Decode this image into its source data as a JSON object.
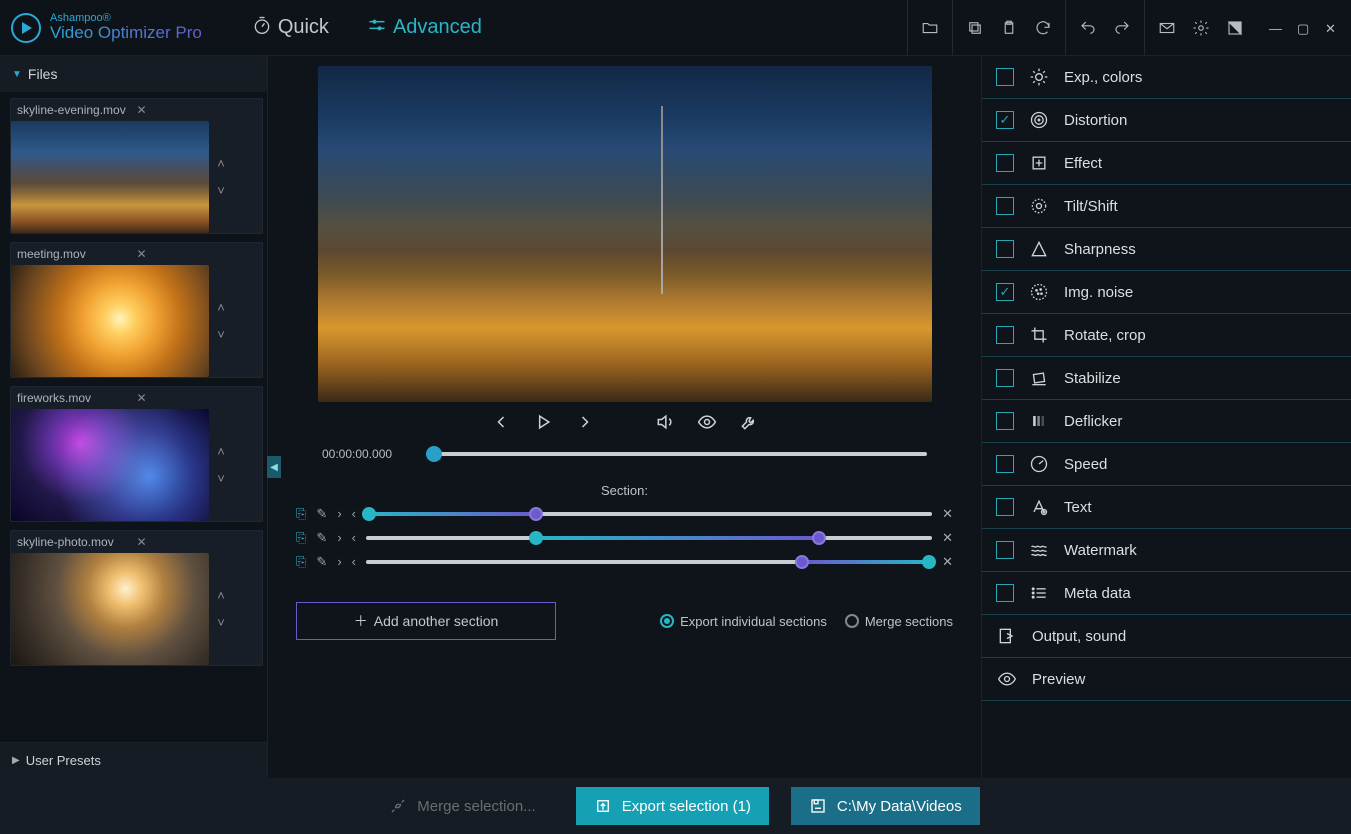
{
  "brand": "Ashampoo®",
  "product": "Video Optimizer Pro",
  "modes": {
    "quick": "Quick",
    "advanced": "Advanced",
    "active": "advanced"
  },
  "topbar_icons": {
    "open": "folder-open",
    "copy": "copy",
    "clipboard": "clipboard",
    "refresh": "refresh",
    "undo": "undo",
    "redo": "redo",
    "mail": "mail",
    "settings": "settings",
    "theme": "theme"
  },
  "sidebar": {
    "files_header": "Files",
    "files": [
      {
        "name": "skyline-evening.mov",
        "thumb": "city"
      },
      {
        "name": "meeting.mov",
        "thumb": "sunset"
      },
      {
        "name": "fireworks.mov",
        "thumb": "fireworks"
      },
      {
        "name": "skyline-photo.mov",
        "thumb": "photo"
      }
    ],
    "presets_header": "User Presets"
  },
  "player": {
    "timecode": "00:00:00.000",
    "section_label": "Section:"
  },
  "sections": {
    "add_label": "Add another section",
    "export_individual": "Export individual sections",
    "merge": "Merge sections",
    "selected": "individual"
  },
  "effects": [
    {
      "key": "exp",
      "label": "Exp., colors",
      "checked": false,
      "icon": "sun"
    },
    {
      "key": "distortion",
      "label": "Distortion",
      "checked": true,
      "icon": "target"
    },
    {
      "key": "effect",
      "label": "Effect",
      "checked": false,
      "icon": "sparkle"
    },
    {
      "key": "tilt",
      "label": "Tilt/Shift",
      "checked": false,
      "icon": "tilt"
    },
    {
      "key": "sharpness",
      "label": "Sharpness",
      "checked": false,
      "icon": "triangle"
    },
    {
      "key": "noise",
      "label": "Img. noise",
      "checked": true,
      "icon": "grain"
    },
    {
      "key": "rotate",
      "label": "Rotate, crop",
      "checked": false,
      "icon": "crop"
    },
    {
      "key": "stabilize",
      "label": "Stabilize",
      "checked": false,
      "icon": "stabilize"
    },
    {
      "key": "deflicker",
      "label": "Deflicker",
      "checked": false,
      "icon": "deflicker"
    },
    {
      "key": "speed",
      "label": "Speed",
      "checked": false,
      "icon": "gauge"
    },
    {
      "key": "text",
      "label": "Text",
      "checked": false,
      "icon": "text"
    },
    {
      "key": "watermark",
      "label": "Watermark",
      "checked": false,
      "icon": "waves"
    },
    {
      "key": "meta",
      "label": "Meta data",
      "checked": false,
      "icon": "list"
    }
  ],
  "effects_extra": [
    {
      "key": "output",
      "label": "Output, sound",
      "icon": "output"
    },
    {
      "key": "preview",
      "label": "Preview",
      "icon": "eye"
    }
  ],
  "bottom": {
    "merge_sel": "Merge selection...",
    "export_sel": "Export selection (1)",
    "output_path": "C:\\My Data\\Videos"
  }
}
